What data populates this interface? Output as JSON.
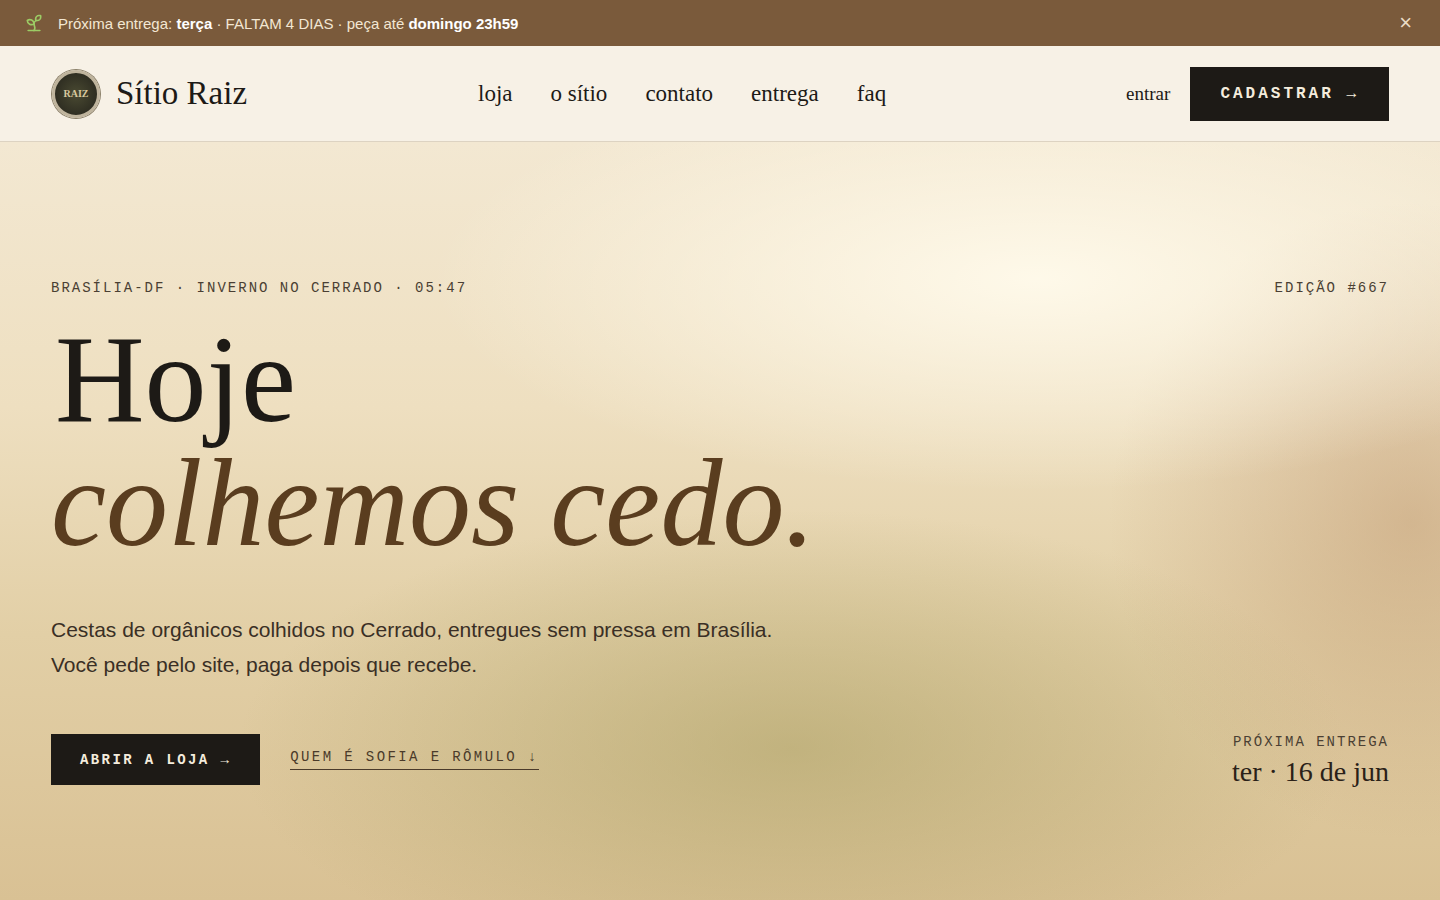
{
  "announcement": {
    "segments": [
      {
        "text": "Próxima entrega: ",
        "bold": false
      },
      {
        "text": "terça",
        "bold": true
      },
      {
        "text": " · FALTAM 4 DIAS · peça até ",
        "bold": false
      },
      {
        "text": "domingo 23h59",
        "bold": true
      }
    ],
    "close": "×"
  },
  "header": {
    "logo_mark": "RAIZ",
    "brand": "Sítio Raiz",
    "nav": [
      {
        "label": "loja",
        "selected": false
      },
      {
        "label": "o sítio",
        "selected": false
      },
      {
        "label": "contato",
        "selected": false
      },
      {
        "label": "entrega",
        "selected": false
      },
      {
        "label": "faq",
        "selected": false
      }
    ],
    "login": "entrar",
    "signup": "CADASTRAR →"
  },
  "hero": {
    "kicker": "BRASÍLIA-DF · INVERNO NO CERRADO · 05:47",
    "edition": "EDIÇÃO #667",
    "headline": [
      "Hoje",
      "colhemos cedo."
    ],
    "lead": [
      "Cestas de orgânicos colhidos no Cerrado, entregues sem pressa em Brasília.",
      "Você pede pelo site, paga depois que recebe."
    ],
    "primary_cta": "ABRIR A LOJA →",
    "secondary_cta": "QUEM É SOFIA E RÔMULO ↓",
    "next_delivery": {
      "label": "PRÓXIMA ENTREGA",
      "date": "ter · 16 de jun"
    }
  }
}
